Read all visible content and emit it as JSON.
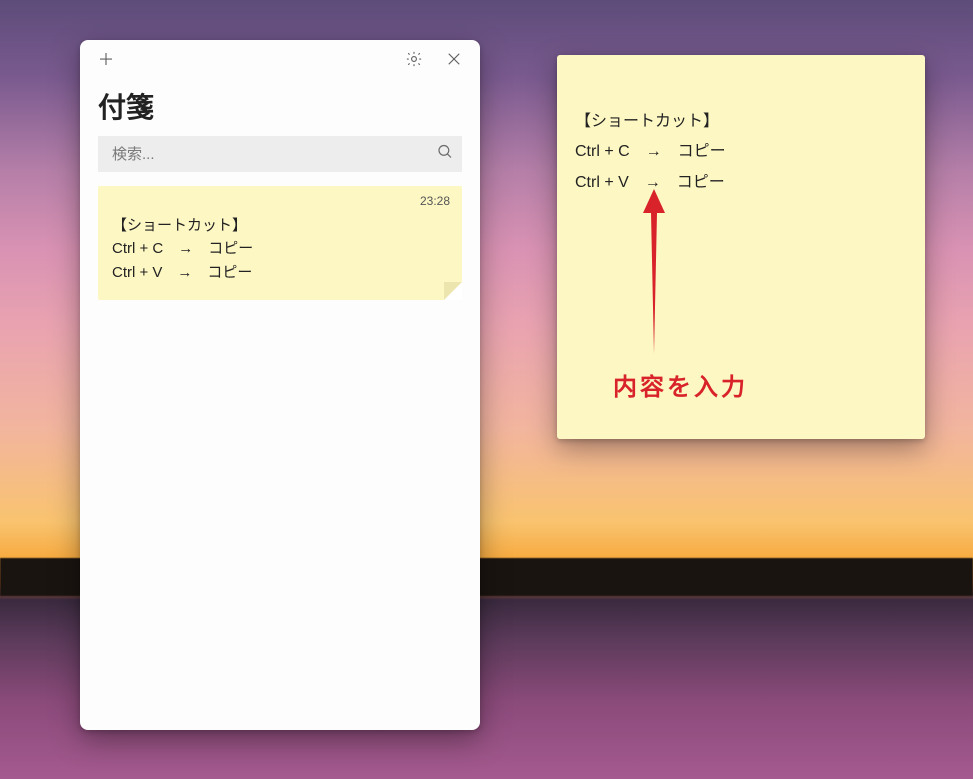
{
  "app": {
    "title": "付箋"
  },
  "titlebar": {
    "new_note": "新しいメモ",
    "settings": "設定",
    "close": "閉じる"
  },
  "search": {
    "placeholder": "検索...",
    "value": ""
  },
  "notes": [
    {
      "time": "23:28",
      "body": "【ショートカット】\nCtrl + C　→　コピー\nCtrl + V　→　コピー"
    }
  ],
  "sticky": {
    "body": "【ショートカット】\nCtrl + C　→　コピー\nCtrl + V　→　コピー"
  },
  "annotation": {
    "label": "内容を入力"
  },
  "colors": {
    "note_bg": "#fdf7c4",
    "annotation": "#d8232a"
  }
}
